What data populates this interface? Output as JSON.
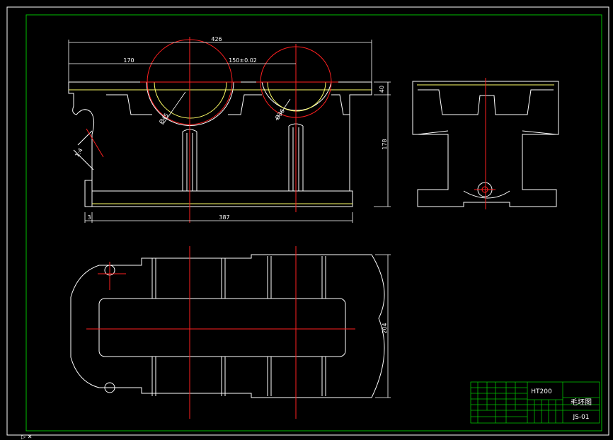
{
  "drawing": {
    "dimensions": {
      "overall_length": "426",
      "left_offset": "170",
      "bore_spacing": "150±0.02",
      "height_top": "40",
      "total_height": "178",
      "base_length": "387",
      "base_offset": "3",
      "plan_width": "204",
      "bore_dia_left": "Ø45",
      "bore_dia_right": "Ø36",
      "chamfer": "1:4"
    },
    "title_block": {
      "material": "HT200",
      "drawing_name": "毛坯图",
      "drawing_number": "JS-01"
    },
    "corner_mark": "▷ ✕"
  },
  "colors": {
    "background": "#000000",
    "frame": "#00c000",
    "outline": "#ffffff",
    "center_line": "#ff2020",
    "hidden": "#ffff66",
    "title_block_lines": "#00c000"
  }
}
